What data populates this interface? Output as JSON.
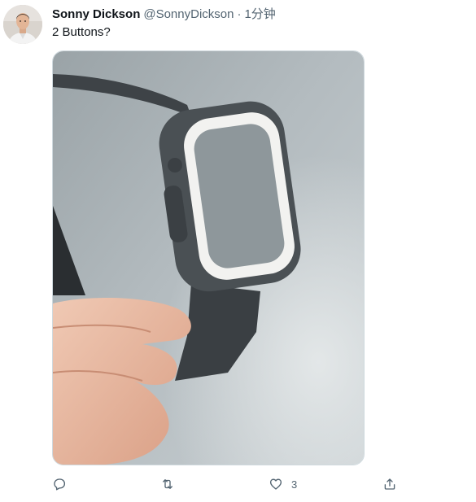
{
  "tweet": {
    "author_name": "Sonny Dickson",
    "author_handle": "@SonnyDickson",
    "separator": "·",
    "time": "1分钟",
    "text": "2 Buttons?",
    "actions": {
      "reply_count": "",
      "retweet_count": "",
      "like_count": "3",
      "share_count": ""
    }
  },
  "colors": {
    "text_primary": "#0f1419",
    "text_secondary": "#536471",
    "border": "#cfd9de"
  },
  "icons": {
    "reply": "reply-icon",
    "retweet": "retweet-icon",
    "like": "heart-icon",
    "share": "share-icon"
  }
}
